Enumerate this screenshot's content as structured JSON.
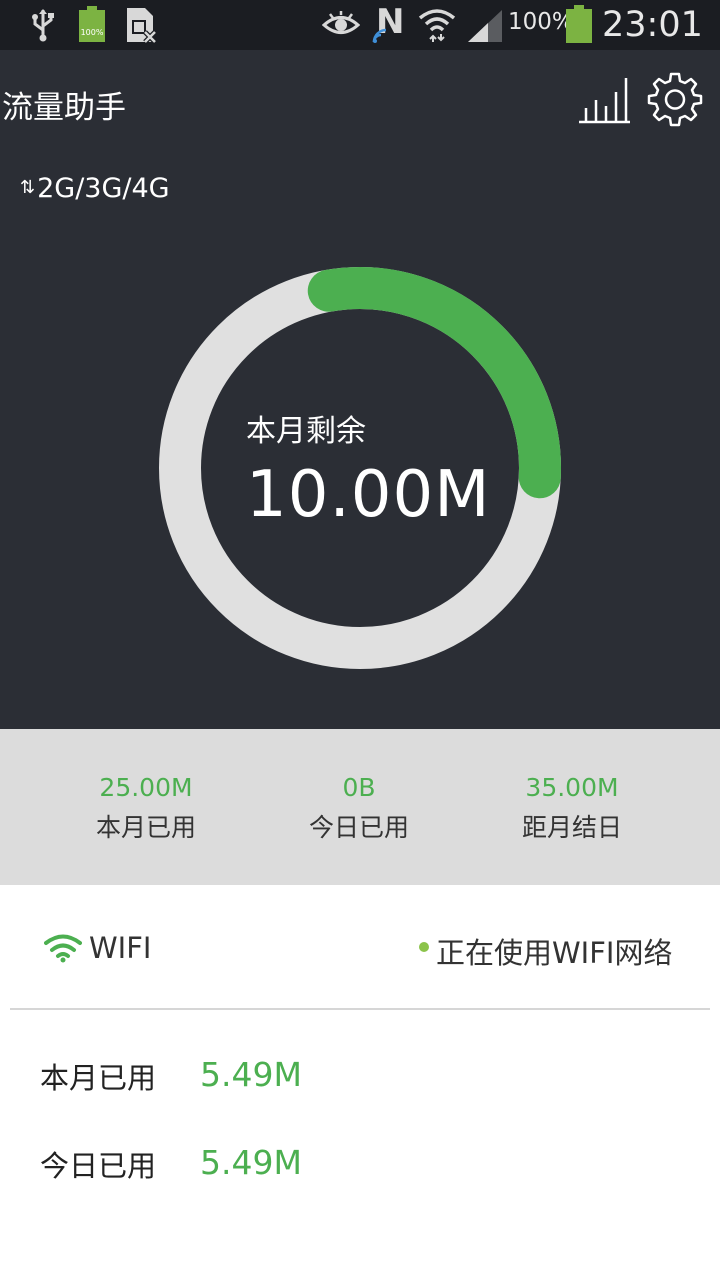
{
  "status_bar": {
    "battery_percent": "100%",
    "battery_small_label": "100%",
    "time": "23:01",
    "n_label": "N"
  },
  "header": {
    "title": "流量助手"
  },
  "network": {
    "arrows": "⇅",
    "label": "2G/3G/4G"
  },
  "gauge": {
    "caption": "本月剩余",
    "value": "10.00M",
    "remaining_fraction": 0.286,
    "ring_color": "#e0e0e0",
    "progress_color": "#4caf50"
  },
  "stats": [
    {
      "value": "25.00M",
      "label": "本月已用"
    },
    {
      "value": "0B",
      "label": "今日已用"
    },
    {
      "value": "35.00M",
      "label": "距月结日"
    }
  ],
  "wifi": {
    "label": "WIFI",
    "status": "正在使用WIFI网络",
    "rows": [
      {
        "label": "本月已用",
        "value": "5.49M"
      },
      {
        "label": "今日已用",
        "value": "5.49M"
      }
    ]
  },
  "colors": {
    "accent": "#4caf50",
    "dark_bg": "#2b2e35",
    "strip_bg": "#dcdcdc"
  }
}
